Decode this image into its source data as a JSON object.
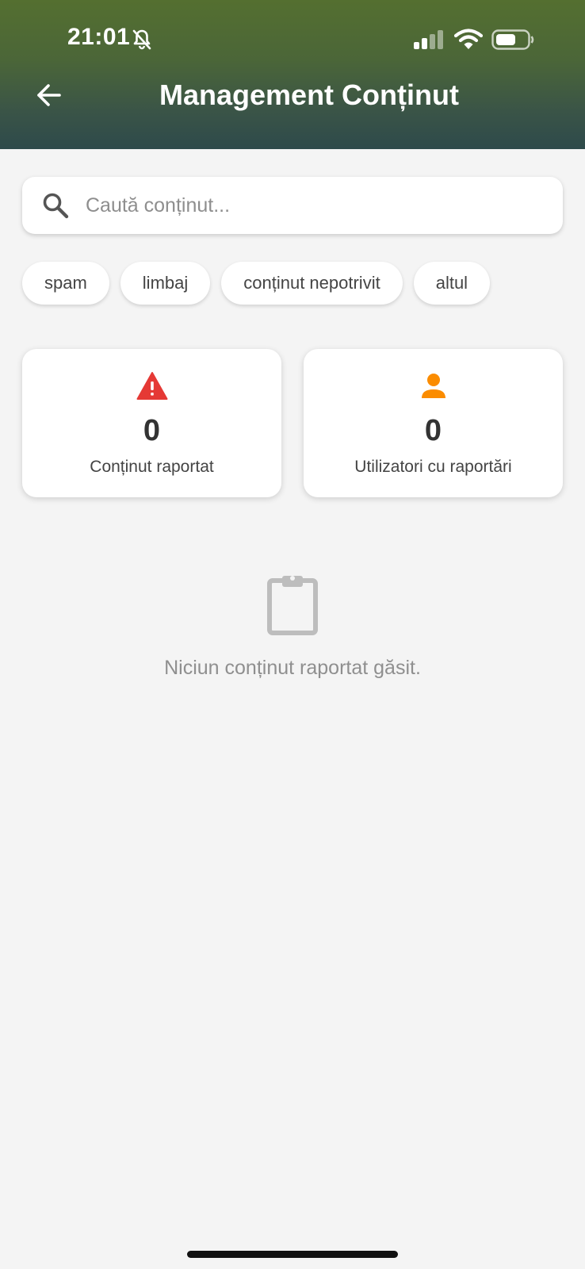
{
  "status_bar": {
    "time": "21:01"
  },
  "header": {
    "title": "Management Conținut"
  },
  "search": {
    "placeholder": "Caută conținut...",
    "value": ""
  },
  "filters": [
    {
      "label": "spam"
    },
    {
      "label": "limbaj"
    },
    {
      "label": "conținut nepotrivit"
    },
    {
      "label": "altul"
    }
  ],
  "stats": [
    {
      "value": "0",
      "label": "Conținut raportat",
      "icon": "warning-icon",
      "color": "#e53935"
    },
    {
      "value": "0",
      "label": "Utilizatori cu raportări",
      "icon": "person-icon",
      "color": "#fb8c00"
    }
  ],
  "empty_state": {
    "icon": "clipboard-icon",
    "message": "Niciun conținut raportat găsit."
  },
  "colors": {
    "header_top": "#546f30",
    "header_bottom": "#2e4a4b",
    "background": "#f4f4f4"
  }
}
